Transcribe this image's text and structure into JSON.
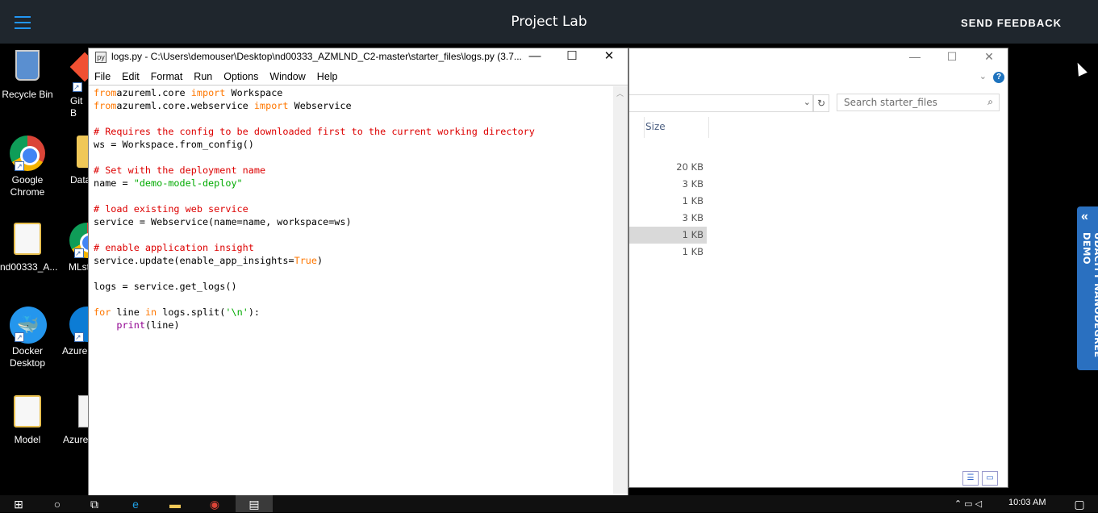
{
  "topbar": {
    "title": "Project Lab",
    "feedback": "SEND FEEDBACK"
  },
  "desktop_icons": [
    {
      "label": "Recycle Bin",
      "icon": "recycle-bin-icon"
    },
    {
      "label": "Git B",
      "icon": "git-bash-icon"
    },
    {
      "label": "Google Chrome",
      "icon": "chrome-icon"
    },
    {
      "label": "Data",
      "icon": "folder-icon"
    },
    {
      "label": "nd00333_A...",
      "icon": "folder-icon"
    },
    {
      "label": "MLst",
      "icon": "chrome-icon"
    },
    {
      "label": "Docker Desktop",
      "icon": "docker-icon"
    },
    {
      "label": "Azure",
      "icon": "edge-icon"
    },
    {
      "label": "Model",
      "icon": "folder-icon"
    },
    {
      "label": "Azure",
      "icon": "document-icon"
    }
  ],
  "explorer": {
    "search_placeholder": "Search starter_files",
    "size_header": "Size",
    "sizes": [
      "20 KB",
      "3 KB",
      "1 KB",
      "3 KB",
      "1 KB",
      "1 KB"
    ],
    "selected_index": 4
  },
  "idle": {
    "title": "logs.py - C:\\Users\\demouser\\Desktop\\nd00333_AZMLND_C2-master\\starter_files\\logs.py (3.7....",
    "menu": [
      "File",
      "Edit",
      "Format",
      "Run",
      "Options",
      "Window",
      "Help"
    ],
    "code": [
      [
        [
          "kw",
          "from"
        ],
        [
          "",
          "azureml.core "
        ],
        [
          "kw",
          "import"
        ],
        [
          "",
          " Workspace"
        ]
      ],
      [
        [
          "kw",
          "from"
        ],
        [
          "",
          "azureml.core.webservice "
        ],
        [
          "kw",
          "import"
        ],
        [
          "",
          " Webservice"
        ]
      ],
      [],
      [
        [
          "cm",
          "# Requires the config to be downloaded first to the current working directory"
        ]
      ],
      [
        [
          "",
          "ws = Workspace.from_config()"
        ]
      ],
      [],
      [
        [
          "cm",
          "# Set with the deployment name"
        ]
      ],
      [
        [
          "",
          "name = "
        ],
        [
          "st",
          "\"demo-model-deploy\""
        ]
      ],
      [],
      [
        [
          "cm",
          "# load existing web service"
        ]
      ],
      [
        [
          "",
          "service = Webservice(name=name, workspace=ws)"
        ]
      ],
      [],
      [
        [
          "cm",
          "# enable application insight"
        ]
      ],
      [
        [
          "",
          "service.update(enable_app_insights="
        ],
        [
          "kw",
          "True"
        ],
        [
          "",
          ")"
        ]
      ],
      [],
      [
        [
          "",
          "logs = service.get_logs()"
        ]
      ],
      [],
      [
        [
          "kw",
          "for"
        ],
        [
          "",
          " line "
        ],
        [
          "kw",
          "in"
        ],
        [
          "",
          " logs.split("
        ],
        [
          "st",
          "'\\n'"
        ],
        [
          "",
          "):"
        ]
      ],
      [
        [
          "",
          "    "
        ],
        [
          "bi",
          "print"
        ],
        [
          "",
          "(line)"
        ]
      ]
    ]
  },
  "udacity_label": "UDACITY NANODEGREE DEMO",
  "taskbar": {
    "clock": "10:03 AM"
  }
}
